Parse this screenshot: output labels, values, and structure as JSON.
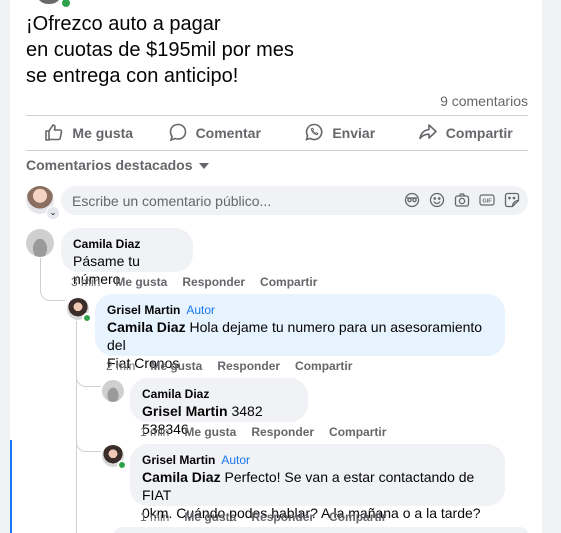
{
  "post": {
    "lines": [
      "¡Ofrezco auto a pagar",
      "en cuotas de $195mil por mes",
      "se entrega con anticipo!"
    ],
    "comment_count": "9 comentarios"
  },
  "actions": {
    "like": "Me gusta",
    "comment": "Comentar",
    "send": "Enviar",
    "share": "Compartir"
  },
  "sort_label": "Comentarios destacados",
  "composer": {
    "placeholder": "Escribe un comentario público...",
    "tools": [
      "avatar-sticker-icon",
      "emoji-icon",
      "camera-icon",
      "gif-icon",
      "sticker-icon"
    ]
  },
  "comments": [
    {
      "author": "Camila Diaz",
      "text": "Pásame tu número",
      "time": "3 min",
      "like": "Me gusta",
      "reply": "Responder",
      "share": "Compartir"
    },
    {
      "author": "Grisel Martin",
      "badge": "Autor",
      "mention": "Camila Diaz",
      "text_line1": "Hola dejame tu numero para un asesoramiento del",
      "text_line2": "Fiat Cronos",
      "time": "2 min",
      "like": "Me gusta",
      "reply": "Responder",
      "share": "Compartir"
    },
    {
      "author": "Camila Diaz",
      "mention": "Grisel Martin",
      "text": "3482 538346",
      "time": "1 min",
      "like": "Me gusta",
      "reply": "Responder",
      "share": "Compartir"
    },
    {
      "author": "Grisel Martin",
      "badge": "Autor",
      "mention": "Camila Diaz",
      "text_line1": "Perfecto! Se van a estar contactando de FIAT",
      "text_line2": "0km. Cuándo podes hablar? A la mañana o a la tarde?",
      "time": "1 min",
      "like": "Me gusta",
      "reply": "Responder",
      "share": "Compartir"
    }
  ],
  "colors": {
    "accent": "#1877f2",
    "secondary_text": "#65676b",
    "bubble": "#f0f2f5",
    "author_bubble": "#e7f3ff",
    "online": "#31a24c"
  }
}
